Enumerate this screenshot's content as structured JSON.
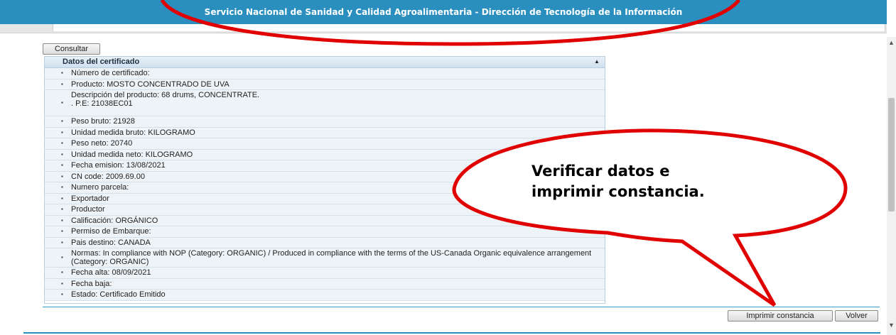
{
  "header": {
    "title": "Servicio Nacional de Sanidad y Calidad Agroalimentaria - Dirección de Tecnología de la Información"
  },
  "toolbar": {
    "consultar_label": "Consultar"
  },
  "panel": {
    "title": "Datos del certificado",
    "rows": [
      {
        "label": "Número de certificado:"
      },
      {
        "label": "Producto: MOSTO CONCENTRADO DE UVA"
      },
      {
        "label": "Descripción del producto: 68 drums, CONCENTRATE. . P.E: 21038EC01"
      },
      {
        "label": "Peso bruto: 21928"
      },
      {
        "label": "Unidad medida bruto: KILOGRAMO"
      },
      {
        "label": "Peso neto: 20740"
      },
      {
        "label": "Unidad medida neto: KILOGRAMO"
      },
      {
        "label": "Fecha emision: 13/08/2021"
      },
      {
        "label": "CN code: 2009.69.00"
      },
      {
        "label": "Numero parcela:"
      },
      {
        "label": "Exportador"
      },
      {
        "label": "Productor"
      },
      {
        "label": "Calificación: ORGÁNICO"
      },
      {
        "label": "Permiso de Embarque:"
      },
      {
        "label": "Pais destino: CANADA"
      },
      {
        "label": "Normas: In compliance with NOP (Category: ORGANIC) / Produced in compliance with the terms of the US-Canada Organic equivalence arrangement (Category: ORGANIC)"
      },
      {
        "label": "Fecha alta: 08/09/2021"
      },
      {
        "label": "Fecha baja:"
      },
      {
        "label": "Estado: Certificado Emitido"
      }
    ]
  },
  "actions": {
    "imprimir_label": "Imprimir constancia",
    "volver_label": "Volver"
  },
  "callout": {
    "line1": "Verificar datos e",
    "line2": "imprimir constancia."
  },
  "colors": {
    "header_bg": "#2a8fbf",
    "callout_stroke": "#e00000"
  }
}
